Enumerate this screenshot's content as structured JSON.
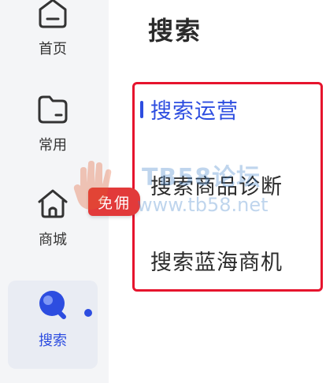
{
  "rail": {
    "items": [
      {
        "label": "首页",
        "icon": "home-icon"
      },
      {
        "label": "常用",
        "icon": "folder-icon"
      },
      {
        "label": "商城",
        "icon": "store-icon"
      },
      {
        "label": "搜索",
        "icon": "search-app-icon",
        "active": true
      }
    ]
  },
  "panel": {
    "title": "搜索",
    "menu": [
      {
        "label": "搜索运营",
        "active": true
      },
      {
        "label": "搜索商品诊断"
      },
      {
        "label": "搜索蓝海商机"
      }
    ]
  },
  "overlay": {
    "promo_tag": "免佣",
    "watermark_title": "TB58论坛",
    "watermark_url": "www.tb58.net"
  },
  "colors": {
    "accent": "#2d4de0",
    "highlight_border": "#e6142d",
    "promo_bg": "#e23a3a",
    "rail_bg": "#f4f5f7",
    "watermark": "#3c7fc9"
  }
}
